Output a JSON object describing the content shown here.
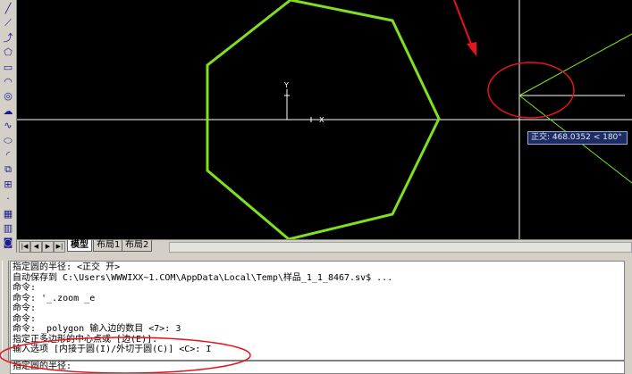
{
  "toolbar": {
    "tools": [
      {
        "icon": "line-icon",
        "glyph": "╱"
      },
      {
        "icon": "construction-line-icon",
        "glyph": "⟋"
      },
      {
        "icon": "polyline-icon",
        "glyph": "⤴"
      },
      {
        "icon": "polygon-icon",
        "glyph": "⬠"
      },
      {
        "icon": "rectangle-icon",
        "glyph": "▭"
      },
      {
        "icon": "arc-icon",
        "glyph": "◠"
      },
      {
        "icon": "circle-icon",
        "glyph": "◎"
      },
      {
        "icon": "revision-cloud-icon",
        "glyph": "☁"
      },
      {
        "icon": "spline-icon",
        "glyph": "∿"
      },
      {
        "icon": "ellipse-icon",
        "glyph": "⬭"
      },
      {
        "icon": "ellipse-arc-icon",
        "glyph": "◜"
      },
      {
        "icon": "insert-block-icon",
        "glyph": "⧉"
      },
      {
        "icon": "make-block-icon",
        "glyph": "⊞"
      },
      {
        "icon": "point-icon",
        "glyph": "·"
      },
      {
        "icon": "hatch-icon",
        "glyph": "▦"
      },
      {
        "icon": "gradient-icon",
        "glyph": "▥"
      },
      {
        "icon": "region-icon",
        "glyph": "◙"
      }
    ]
  },
  "canvas": {
    "background": "#000000",
    "polygon_color": "#80e020",
    "crosshair_color": "#ffffff",
    "tracking_line_color": "#80e020",
    "annotation_color": "#e8141c",
    "ucs_x_label": "X",
    "ucs_y_label": "Y",
    "tooltip": "正交: 468.0352 < 180°"
  },
  "tabs": {
    "nav_buttons": [
      "|◀",
      "◀",
      "▶",
      "▶|"
    ],
    "items": [
      {
        "label": "模型",
        "active": true
      },
      {
        "label": "布局1",
        "active": false
      },
      {
        "label": "布局2",
        "active": false
      }
    ]
  },
  "command": {
    "history": [
      "指定圆的半径: <正交 开>",
      "自动保存到 C:\\Users\\WWWIXX~1.COM\\AppData\\Local\\Temp\\样品_1_1_8467.sv$ ...",
      "命令:",
      "命令: '_.zoom _e",
      "命令:",
      "命令:",
      "命令: _polygon 输入边的数目 <7>: 3",
      "指定正多边形的中心点或 [边(E)]:",
      "输入选项 [内接于圆(I)/外切于圆(C)] <C>: I"
    ],
    "prompt": "指定圆的半径:"
  }
}
